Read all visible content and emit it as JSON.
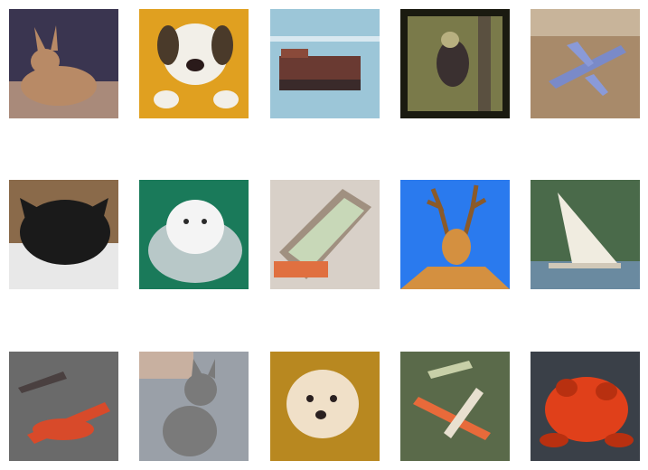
{
  "grid": {
    "rows": 3,
    "columns": 5,
    "tiles": [
      {
        "subject": "cat",
        "bg": "#3a3550",
        "accent": "#b88a66",
        "mid": "#a98a7a"
      },
      {
        "subject": "dog",
        "bg": "#e0a020",
        "accent": "#f2efe8",
        "mid": "#4a3a2a"
      },
      {
        "subject": "ship",
        "bg": "#9cc6d8",
        "accent": "#6a3a32",
        "mid": "#3a2a2a"
      },
      {
        "subject": "bird",
        "bg": "#7a7a4a",
        "accent": "#3a3030",
        "mid": "#b8b080"
      },
      {
        "subject": "airplane",
        "bg": "#a88a6a",
        "accent": "#7a8ac8",
        "mid": "#c8b49a"
      },
      {
        "subject": "cat",
        "bg": "#8a6a4a",
        "accent": "#1a1a1a",
        "mid": "#e8e8e8"
      },
      {
        "subject": "dog",
        "bg": "#1a7a5a",
        "accent": "#f4f4f4",
        "mid": "#b8c8c8"
      },
      {
        "subject": "truck",
        "bg": "#d8d0c8",
        "accent": "#c8d8b8",
        "mid": "#e07040"
      },
      {
        "subject": "deer",
        "bg": "#2a7aee",
        "accent": "#d49040",
        "mid": "#8a5a2a"
      },
      {
        "subject": "ship",
        "bg": "#4a6a4a",
        "accent": "#f0ece0",
        "mid": "#6a8aa0"
      },
      {
        "subject": "airplane",
        "bg": "#6a6a6a",
        "accent": "#d84a2a",
        "mid": "#4a4040"
      },
      {
        "subject": "cat",
        "bg": "#9aa0a8",
        "accent": "#7a7a7a",
        "mid": "#c8b0a0"
      },
      {
        "subject": "dog",
        "bg": "#b88820",
        "accent": "#f0e0c8",
        "mid": "#2a2020"
      },
      {
        "subject": "airplane",
        "bg": "#5a6a4a",
        "accent": "#e86a3a",
        "mid": "#e8e0d0"
      },
      {
        "subject": "frog",
        "bg": "#3a4048",
        "accent": "#e0401a",
        "mid": "#b83010"
      }
    ]
  }
}
